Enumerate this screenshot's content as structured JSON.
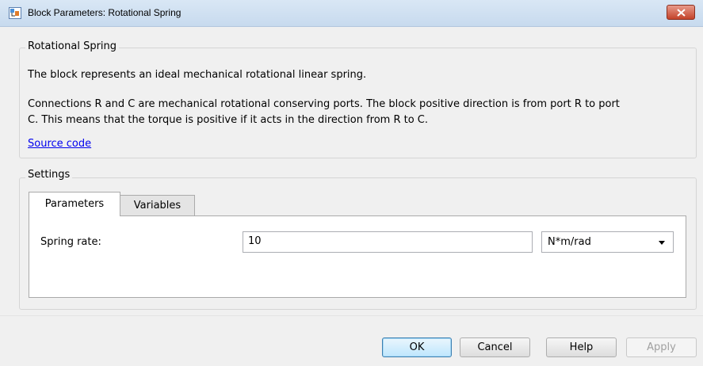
{
  "window": {
    "title": "Block Parameters: Rotational Spring"
  },
  "block_group": {
    "label": "Rotational Spring",
    "description": "The block represents an ideal mechanical rotational linear spring.",
    "details_line1": "Connections R and C are mechanical rotational conserving ports. The block positive direction is from port R to port",
    "details_line2": "C. This means that the torque is positive if it acts in the direction from R to C.",
    "source_link": "Source code"
  },
  "settings_group": {
    "label": "Settings",
    "tabs": [
      {
        "label": "Parameters",
        "active": true
      },
      {
        "label": "Variables",
        "active": false
      }
    ],
    "parameters": [
      {
        "label": "Spring rate:",
        "value": "10",
        "unit": "N*m/rad"
      }
    ]
  },
  "buttons": {
    "ok": "OK",
    "cancel": "Cancel",
    "help": "Help",
    "apply": "Apply"
  },
  "colors": {
    "link": "#0000ee",
    "close_button": "#c4432a",
    "titlebar": "#c7daee"
  }
}
